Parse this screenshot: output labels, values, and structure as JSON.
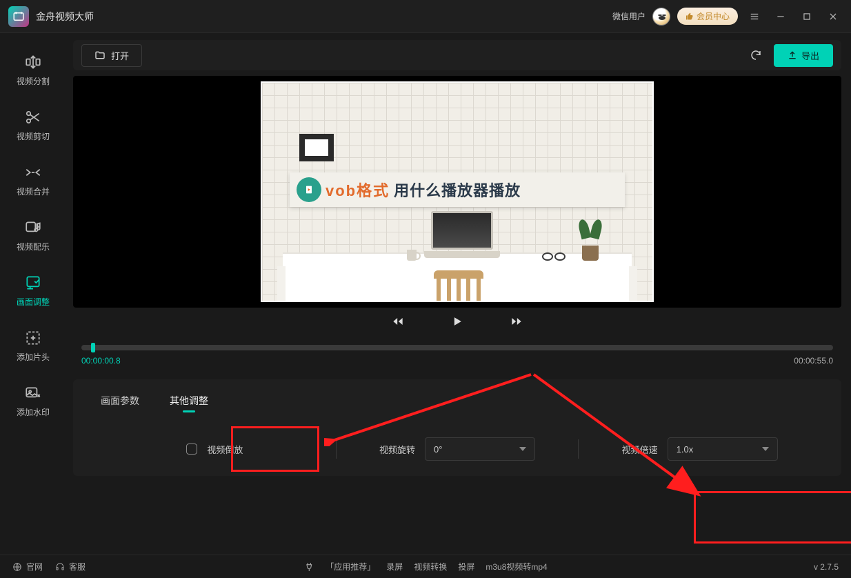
{
  "app": {
    "title": "金舟视频大师"
  },
  "titlebar": {
    "wechat_label": "微信用户",
    "vip_label": "会员中心"
  },
  "sidebar": {
    "items": [
      {
        "label": "视频分割"
      },
      {
        "label": "视频剪切"
      },
      {
        "label": "视频合并"
      },
      {
        "label": "视频配乐"
      },
      {
        "label": "画面调整"
      },
      {
        "label": "添加片头"
      },
      {
        "label": "添加水印"
      }
    ]
  },
  "toolbar": {
    "open_label": "打开",
    "export_label": "导出"
  },
  "preview": {
    "banner_text_1": "vob格式",
    "banner_text_2": "用什么播放器播放"
  },
  "timeline": {
    "current": "00:00:00.8",
    "total": "00:00:55.0"
  },
  "tabs": {
    "items": [
      {
        "label": "画面参数"
      },
      {
        "label": "其他调整"
      }
    ]
  },
  "controls": {
    "reverse_label": "视频倒放",
    "rotate_label": "视频旋转",
    "rotate_value": "0°",
    "speed_label": "视频倍速",
    "speed_value": "1.0x"
  },
  "footer": {
    "official": "官网",
    "service": "客服",
    "recommend": "「应用推荐」",
    "screen_record": "录屏",
    "video_convert": "视频转换",
    "cast": "投屏",
    "m3u8": "m3u8视频转mp4",
    "version": "v 2.7.5"
  }
}
